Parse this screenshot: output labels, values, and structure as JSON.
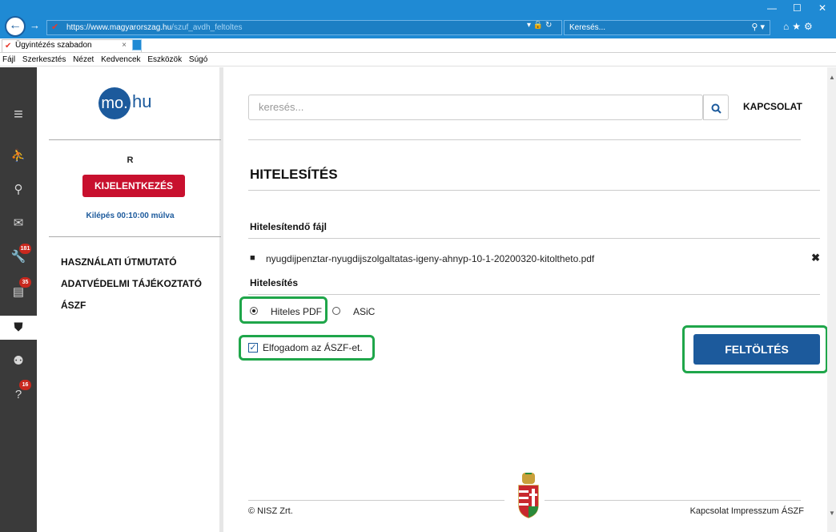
{
  "browser": {
    "url_host": "https://www.magyarorszag.hu",
    "url_path": "/szuf_avdh_feltoltes",
    "search_placeholder": "Keresés...",
    "tab_title": "Ügyintézés szabadon",
    "menu": [
      "Fájl",
      "Szerkesztés",
      "Nézet",
      "Kedvencek",
      "Eszközök",
      "Súgó"
    ]
  },
  "iconbar": {
    "badges": {
      "wrench": "181",
      "news": "35",
      "help": "16"
    }
  },
  "sidebar": {
    "logo_circle": "mo.",
    "logo_text": "hu",
    "user_initial": "R",
    "logout_label": "KIJELENTKEZÉS",
    "timer_text": "Kilépés 00:10:00 múlva",
    "links": [
      "HASZNÁLATI ÚTMUTATÓ",
      "ADATVÉDELMI TÁJÉKOZTATÓ",
      "ÁSZF"
    ]
  },
  "main": {
    "search_placeholder": "keresés...",
    "contact": "KAPCSOLAT",
    "title": "HITELESÍTÉS",
    "file_label": "Hitelesítendő fájl",
    "file_name": "nyugdijpenztar-nyugdijszolgaltatas-igeny-ahnyp-10-1-20200320-kitoltheto.pdf",
    "auth_label": "Hitelesítés",
    "option_pdf": "Hiteles PDF",
    "option_asic": "ASiC",
    "accept_label": "Elfogadom az ÁSZF-et.",
    "upload_label": "FELTÖLTÉS"
  },
  "footer": {
    "copyright": "© NISZ Zrt.",
    "links": "Kapcsolat Impresszum ÁSZF"
  }
}
